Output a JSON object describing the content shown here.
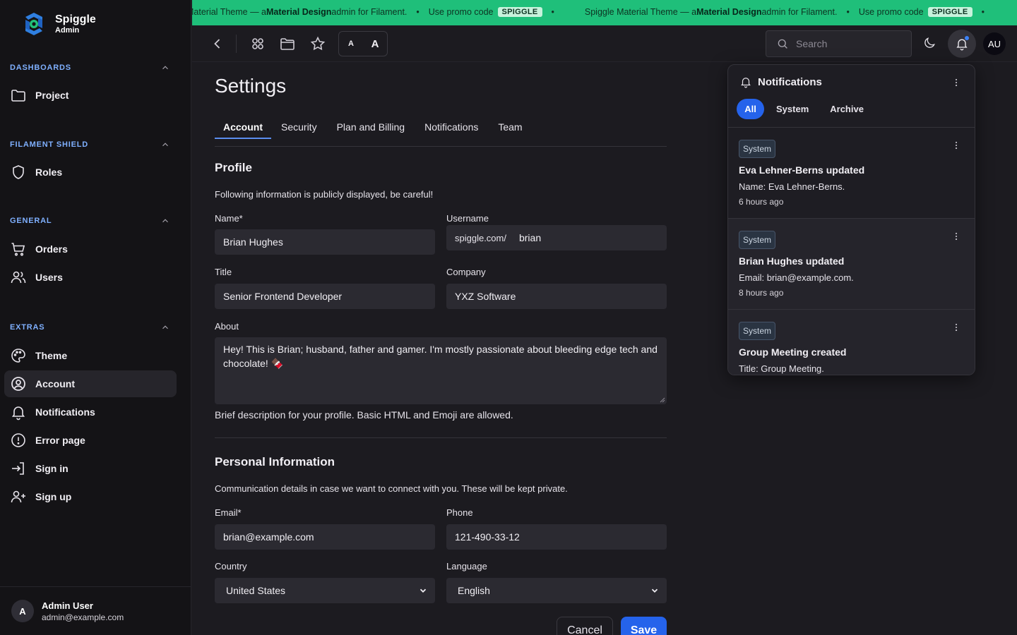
{
  "brand": {
    "name": "Spiggle",
    "sub": "Admin"
  },
  "sidebar": {
    "groups": [
      {
        "label": "DASHBOARDS",
        "items": [
          {
            "label": "Project",
            "icon": "folder-icon"
          }
        ]
      },
      {
        "label": "FILAMENT SHIELD",
        "items": [
          {
            "label": "Roles",
            "icon": "shield-icon"
          }
        ]
      },
      {
        "label": "GENERAL",
        "items": [
          {
            "label": "Orders",
            "icon": "cart-icon"
          },
          {
            "label": "Users",
            "icon": "users-icon"
          }
        ]
      },
      {
        "label": "EXTRAS",
        "items": [
          {
            "label": "Theme",
            "icon": "palette-icon"
          },
          {
            "label": "Account",
            "icon": "user-circle-icon",
            "active": true
          },
          {
            "label": "Notifications",
            "icon": "bell-icon"
          },
          {
            "label": "Error page",
            "icon": "exclamation-circle-icon"
          },
          {
            "label": "Sign in",
            "icon": "sign-in-icon"
          },
          {
            "label": "Sign up",
            "icon": "user-plus-icon"
          }
        ]
      }
    ],
    "user": {
      "initial": "A",
      "name": "Admin User",
      "email": "admin@example.com"
    }
  },
  "promo": {
    "prefix": "Material Theme — a ",
    "strong": "Material Design",
    "suffix": " admin for Filament.",
    "promo_label": "Use promo code",
    "code": "SPIGGLE",
    "full_prefix": "Spiggle Material Theme — a "
  },
  "topbar": {
    "font_small": "A",
    "font_large": "A",
    "search_placeholder": "Search",
    "avatar_initials": "AU"
  },
  "page": {
    "title": "Settings",
    "tabs": [
      "Account",
      "Security",
      "Plan and Billing",
      "Notifications",
      "Team"
    ],
    "active_tab": "Account"
  },
  "profile": {
    "title": "Profile",
    "description": "Following information is publicly displayed, be careful!",
    "name_label": "Name*",
    "name_value": "Brian Hughes",
    "username_label": "Username",
    "username_prefix": "spiggle.com/",
    "username_value": "brian",
    "title_label": "Title",
    "title_value": "Senior Frontend Developer",
    "company_label": "Company",
    "company_value": "YXZ Software",
    "about_label": "About",
    "about_value": "Hey! This is Brian; husband, father and gamer. I'm mostly passionate about bleeding edge tech and chocolate! 🍫",
    "about_helper": "Brief description for your profile. Basic HTML and Emoji are allowed."
  },
  "personal": {
    "title": "Personal Information",
    "description": "Communication details in case we want to connect with you. These will be kept private.",
    "email_label": "Email*",
    "email_value": "brian@example.com",
    "phone_label": "Phone",
    "phone_value": "121-490-33-12",
    "country_label": "Country",
    "country_value": "United States",
    "language_label": "Language",
    "language_value": "English"
  },
  "actions": {
    "cancel": "Cancel",
    "save": "Save"
  },
  "notifications": {
    "title": "Notifications",
    "tabs": [
      "All",
      "System",
      "Archive"
    ],
    "active_tab": "All",
    "items": [
      {
        "badge": "System",
        "title": "Eva Lehner-Berns updated",
        "body": "Name: Eva Lehner-Berns.",
        "time": "6 hours ago"
      },
      {
        "badge": "System",
        "title": "Brian Hughes updated",
        "body": "Email: brian@example.com.",
        "time": "8 hours ago"
      },
      {
        "badge": "System",
        "title": "Group Meeting created",
        "body": "Title: Group Meeting.",
        "time": ""
      }
    ]
  },
  "colors": {
    "accent": "#2563eb",
    "banner": "#1fbf7a",
    "sidebar_group": "#7fb0ff"
  }
}
